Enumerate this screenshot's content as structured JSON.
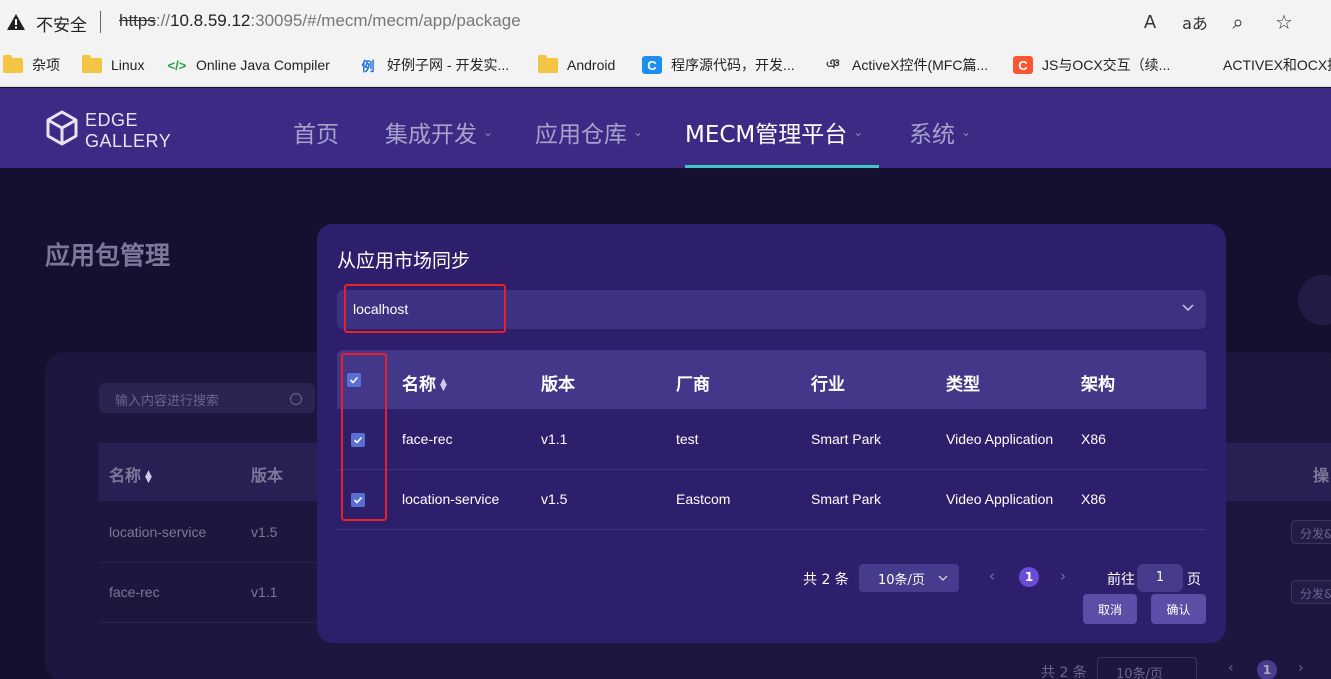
{
  "browser": {
    "insecure_label": "不安全",
    "url_scheme": "https",
    "url_host": "10.8.59.12",
    "url_rest": ":30095/#/mecm/mecm/app/package",
    "read_aloud_icon": "A",
    "translate_icon": "aあ",
    "zoom_icon": "⌕",
    "favorite_icon": "☆"
  },
  "bookmarks": [
    {
      "label": "杂项",
      "icon": "folder-icon"
    },
    {
      "label": "Linux",
      "icon": "folder-icon"
    },
    {
      "label": "Online Java Compiler",
      "icon": "code-icon",
      "glyph": "</>"
    },
    {
      "label": "好例子网 - 开发实...",
      "icon": "example-icon",
      "glyph": "例"
    },
    {
      "label": "Android",
      "icon": "folder-icon"
    },
    {
      "label": "程序源代码，开发...",
      "icon": "c-icon",
      "glyph": "C"
    },
    {
      "label": "ActiveX控件(MFC篇...",
      "icon": "feather-icon",
      "glyph": "ঞ"
    },
    {
      "label": "JS与OCX交互（续...",
      "icon": "csdn-icon",
      "glyph": "C"
    },
    {
      "label": "ACTIVEX和OCX控",
      "icon": "blank-icon"
    }
  ],
  "app": {
    "logo_line1": "EDGE",
    "logo_line2": "GALLERY",
    "nav": [
      {
        "label": "首页",
        "dropdown": false
      },
      {
        "label": "集成开发",
        "dropdown": true
      },
      {
        "label": "应用仓库",
        "dropdown": true
      },
      {
        "label": "MECM管理平台",
        "dropdown": true,
        "active": true
      },
      {
        "label": "系统",
        "dropdown": true
      }
    ],
    "chevron": "⌄",
    "accent_color": "#3fc7c1"
  },
  "background_page": {
    "title": "应用包管理",
    "search_placeholder": "输入内容进行搜索",
    "columns": [
      "名称",
      "版本"
    ],
    "ops_header": "操",
    "rows": [
      {
        "name": "location-service",
        "version": "v1.5",
        "action": "分发&"
      },
      {
        "name": "face-rec",
        "version": "v1.1",
        "action": "分发&"
      }
    ],
    "total": "共 2 条",
    "page_size": "10条/页",
    "current_page": "1"
  },
  "modal": {
    "title": "从应用市场同步",
    "select_value": "localhost",
    "columns": [
      "名称",
      "版本",
      "厂商",
      "行业",
      "类型",
      "架构"
    ],
    "rows": [
      {
        "name": "face-rec",
        "version": "v1.1",
        "vendor": "test",
        "industry": "Smart Park",
        "type": "Video Application",
        "arch": "X86",
        "checked": true
      },
      {
        "name": "location-service",
        "version": "v1.5",
        "vendor": "Eastcom",
        "industry": "Smart Park",
        "type": "Video Application",
        "arch": "X86",
        "checked": true
      }
    ],
    "header_checked": true,
    "total": "共 2 条",
    "page_size": "10条/页",
    "prev": "‹",
    "next": "›",
    "current_page": "1",
    "goto_prefix": "前往",
    "goto_value": "1",
    "goto_suffix": "页",
    "cancel_label": "取消",
    "confirm_label": "确认",
    "highlight_color": "#e8202b"
  }
}
